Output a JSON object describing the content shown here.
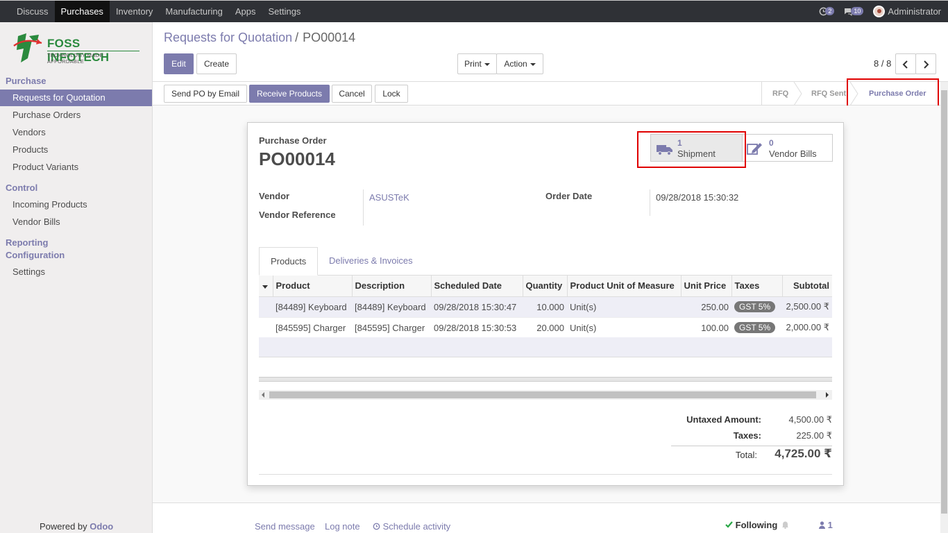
{
  "topbar": {
    "menu": [
      "Discuss",
      "Purchases",
      "Inventory",
      "Manufacturing",
      "Apps",
      "Settings"
    ],
    "active": "Purchases",
    "activity_count": "2",
    "message_count": "10",
    "user": "Administrator"
  },
  "logo": {
    "brand": "FOSS INFOTECH",
    "tagline": "TECHNOLOGY MADE AFFORDABLE"
  },
  "sidebar": {
    "sections": [
      {
        "title": "Purchase",
        "items": [
          "Requests for Quotation",
          "Purchase Orders",
          "Vendors",
          "Products",
          "Product Variants"
        ]
      },
      {
        "title": "Control",
        "items": [
          "Incoming Products",
          "Vendor Bills"
        ]
      },
      {
        "title": "Reporting",
        "items": []
      },
      {
        "title": "Configuration",
        "items": [
          "Settings"
        ]
      }
    ],
    "active_item": "Requests for Quotation",
    "powered_prefix": "Powered by",
    "powered_brand": "Odoo"
  },
  "control_panel": {
    "breadcrumb_parent": "Requests for Quotation",
    "breadcrumb_separator": "/",
    "breadcrumb_current": "PO00014",
    "edit": "Edit",
    "create": "Create",
    "print": "Print",
    "action": "Action",
    "pager": "8 / 8"
  },
  "statusbar": {
    "buttons": [
      "Send PO by Email",
      "Receive Products",
      "Cancel",
      "Lock"
    ],
    "stages": [
      "RFQ",
      "RFQ Sent",
      "Purchase Order"
    ],
    "active_stage": "Purchase Order"
  },
  "sheet": {
    "doc_type": "Purchase Order",
    "doc_name": "PO00014",
    "smart_buttons": [
      {
        "count": "1",
        "label": "Shipment"
      },
      {
        "count": "0",
        "label": "Vendor Bills"
      }
    ],
    "vendor_label": "Vendor",
    "vendor_value": "ASUSTeK",
    "vendor_ref_label": "Vendor Reference",
    "order_date_label": "Order Date",
    "order_date_value": "09/28/2018 15:30:32",
    "tabs": [
      "Products",
      "Deliveries & Invoices"
    ],
    "columns": [
      "Product",
      "Description",
      "Scheduled Date",
      "Quantity",
      "Product Unit of Measure",
      "Unit Price",
      "Taxes",
      "Subtotal"
    ],
    "lines": [
      {
        "product": "[84489] Keyboard",
        "description": "[84489] Keyboard",
        "date": "09/28/2018 15:30:47",
        "qty": "10.000",
        "uom": "Unit(s)",
        "price": "250.00",
        "tax": "GST 5%",
        "subtotal": "2,500.00 ₹"
      },
      {
        "product": "[845595] Charger",
        "description": "[845595] Charger",
        "date": "09/28/2018 15:30:53",
        "qty": "20.000",
        "uom": "Unit(s)",
        "price": "100.00",
        "tax": "GST 5%",
        "subtotal": "2,000.00 ₹"
      }
    ],
    "untaxed_label": "Untaxed Amount:",
    "untaxed_value": "4,500.00 ₹",
    "taxes_label": "Taxes:",
    "taxes_value": "225.00 ₹",
    "total_label": "Total:",
    "total_value": "4,725.00 ₹"
  },
  "chatter": {
    "send_message": "Send message",
    "log_note": "Log note",
    "schedule_activity": "Schedule activity",
    "following": "Following",
    "followers": "1"
  },
  "colors": {
    "accent": "#7c7bad",
    "topbar": "#2f3136",
    "highlight": "#e00000"
  }
}
